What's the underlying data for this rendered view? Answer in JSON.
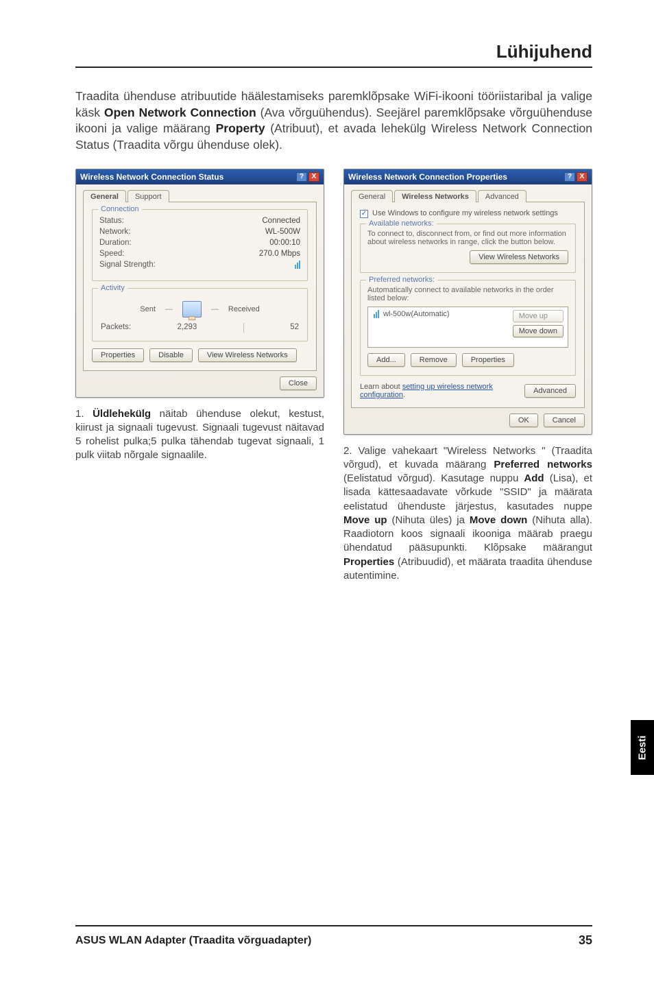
{
  "header": {
    "title": "Lühijuhend"
  },
  "intro": {
    "p1a": "Traadita ühenduse atribuutide häälestamiseks paremklõpsake WiFi-ikooni tööriistaribal ja valige käsk ",
    "p1b_bold": "Open Network Connection",
    "p1c": " (Ava võrguühendus). Seejärel paremklõpsake võrguühenduse ikooni ja valige määrang ",
    "p1d_bold": "Property",
    "p1e": " (Atribuut), et avada lehekülg Wireless Network Connection Status (Traadita võrgu ühenduse olek)."
  },
  "dialog1": {
    "title": "Wireless Network Connection Status",
    "help": "?",
    "close": "X",
    "tabs": {
      "general": "General",
      "support": "Support"
    },
    "connection": {
      "legend": "Connection",
      "status_k": "Status:",
      "status_v": "Connected",
      "network_k": "Network:",
      "network_v": "WL-500W",
      "duration_k": "Duration:",
      "duration_v": "00:00:10",
      "speed_k": "Speed:",
      "speed_v": "270.0 Mbps",
      "signal_k": "Signal Strength:"
    },
    "activity": {
      "legend": "Activity",
      "sent_lbl": "Sent",
      "recv_lbl": "Received",
      "packets_lbl": "Packets:",
      "sent_val": "2,293",
      "recv_val": "52"
    },
    "buttons": {
      "properties": "Properties",
      "disable": "Disable",
      "view": "View Wireless Networks",
      "close": "Close"
    }
  },
  "dialog2": {
    "title": "Wireless Network Connection Properties",
    "help": "?",
    "close": "X",
    "tabs": {
      "general": "General",
      "wireless": "Wireless Networks",
      "advanced": "Advanced"
    },
    "use_windows": "Use Windows to configure my wireless network settings",
    "available": {
      "legend": "Available networks:",
      "desc": "To connect to, disconnect from, or find out more information about wireless networks in range, click the button below.",
      "view_btn": "View Wireless Networks"
    },
    "preferred": {
      "legend": "Preferred networks:",
      "desc": "Automatically connect to available networks in the order listed below:",
      "entry": "wl-500w(Automatic)",
      "moveup": "Move up",
      "movedown": "Move down",
      "add": "Add...",
      "remove": "Remove",
      "properties": "Properties"
    },
    "learn_a": "Learn about ",
    "learn_link": "setting up wireless network configuration",
    "learn_b": ".",
    "advanced_btn": "Advanced",
    "ok": "OK",
    "cancel": "Cancel"
  },
  "caption1": {
    "num": "1. ",
    "b": "Üldlehekülg",
    "rest": " näitab ühenduse olekut, kestust, kiirust ja signaali tugevust. Signaali tugevust näitavad 5 rohelist pulka;5 pulka tähendab tugevat signaali, 1 pulk viitab nõrgale signaalile."
  },
  "caption2": {
    "num": "2. ",
    "a": "Valige vahekaart \"Wireless Networks \" (Traadita võrgud), et kuvada määrang ",
    "b1": "Preferred networks",
    "c": " (Eelistatud võrgud). Kasutage nuppu ",
    "b2": "Add",
    "d": " (Lisa), et lisada kättesaadavate võrkude \"SSID\" ja määrata eelistatud ühenduste järjestus, kasutades nuppe ",
    "b3": "Move up",
    "e": " (Nihuta üles) ja ",
    "b4": "Move down",
    "f": " (Nihuta alla). Raadiotorn koos signaali ikooniga määrab praegu ühendatud pääsupunkti. Klõpsake määrangut ",
    "b5": "Properties",
    "g": " (Atribuudid), et määrata traadita ühenduse autentimine."
  },
  "side_tab": "Eesti",
  "footer": {
    "left": "ASUS WLAN Adapter (Traadita võrguadapter)",
    "right": "35"
  }
}
